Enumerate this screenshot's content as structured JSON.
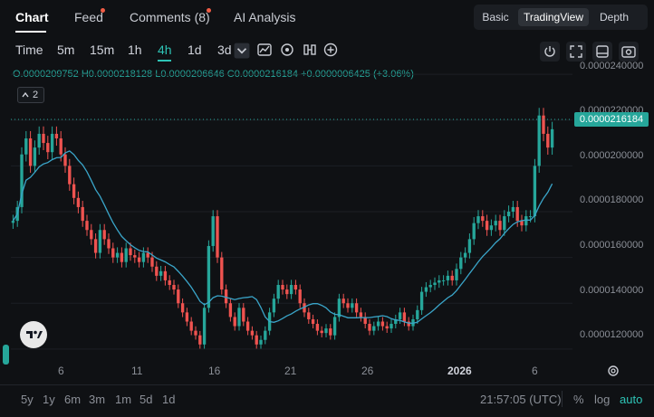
{
  "top_tabs": [
    {
      "label": "Chart",
      "active": true,
      "dot": false
    },
    {
      "label": "Feed",
      "active": false,
      "dot": true
    },
    {
      "label": "Comments (8)",
      "active": false,
      "dot": true
    },
    {
      "label": "AI Analysis",
      "active": false,
      "dot": false
    }
  ],
  "view_modes": [
    {
      "label": "Basic",
      "active": false
    },
    {
      "label": "TradingView",
      "active": true
    },
    {
      "label": "Depth",
      "active": false
    }
  ],
  "toolbar": {
    "time_label": "Time",
    "intervals": [
      {
        "label": "5m",
        "active": false
      },
      {
        "label": "15m",
        "active": false
      },
      {
        "label": "1h",
        "active": false
      },
      {
        "label": "4h",
        "active": true
      },
      {
        "label": "1d",
        "active": false
      },
      {
        "label": "3d",
        "active": false
      }
    ],
    "icons": [
      "chevron-down-icon",
      "chart-style-icon",
      "indicator-icon",
      "compare-icon",
      "add-icon"
    ],
    "right_icons": [
      "power-icon",
      "fullscreen-icon",
      "window-icon",
      "camera-icon"
    ]
  },
  "ohlc": {
    "open": "O.0000209752",
    "high": "H0.0000218128",
    "low": "L0.0000206646",
    "close": "C0.0000216184",
    "change": "+0.0000006425 (+3.06%)"
  },
  "indicator_badge": "2",
  "price_axis": [
    "0.0000240000",
    "0.0000220000",
    "0.0000200000",
    "0.0000180000",
    "0.0000160000",
    "0.0000140000",
    "0.0000120000"
  ],
  "current_price": "0.0000216184",
  "time_axis": [
    {
      "label": "6",
      "bold": false
    },
    {
      "label": "11",
      "bold": false
    },
    {
      "label": "16",
      "bold": false
    },
    {
      "label": "21",
      "bold": false
    },
    {
      "label": "26",
      "bold": false
    },
    {
      "label": "2026",
      "bold": true
    },
    {
      "label": "6",
      "bold": false
    }
  ],
  "ranges": [
    "5y",
    "1y",
    "6m",
    "3m",
    "1m",
    "5d",
    "1d"
  ],
  "clock": "21:57:05 (UTC)",
  "scale_options": [
    {
      "label": "%",
      "active": false
    },
    {
      "label": "log",
      "active": false
    },
    {
      "label": "auto",
      "active": true
    }
  ],
  "colors": {
    "up": "#26a69a",
    "down": "#ef5350",
    "ma": "#3aa5c9",
    "accent": "#2ec4b6"
  },
  "chart_data": {
    "type": "candlestick",
    "ma_color": "#3aa5c9",
    "ylim": [
      1.16e-05,
      2.44e-05
    ],
    "closes": [
      1.76e-05,
      1.82e-05,
      2.05e-05,
      2.12e-05,
      2e-05,
      2.08e-05,
      2.14e-05,
      2.1e-05,
      2.06e-05,
      2.14e-05,
      2.12e-05,
      2.05e-05,
      2e-05,
      1.92e-05,
      1.86e-05,
      1.82e-05,
      1.76e-05,
      1.72e-05,
      1.68e-05,
      1.62e-05,
      1.72e-05,
      1.68e-05,
      1.64e-05,
      1.6e-05,
      1.62e-05,
      1.58e-05,
      1.64e-05,
      1.61e-05,
      1.6e-05,
      1.58e-05,
      1.62e-05,
      1.6e-05,
      1.56e-05,
      1.52e-05,
      1.54e-05,
      1.5e-05,
      1.48e-05,
      1.46e-05,
      1.4e-05,
      1.36e-05,
      1.32e-05,
      1.28e-05,
      1.26e-05,
      1.22e-05,
      1.38e-05,
      1.65e-05,
      1.78e-05,
      1.6e-05,
      1.46e-05,
      1.4e-05,
      1.34e-05,
      1.3e-05,
      1.38e-05,
      1.32e-05,
      1.28e-05,
      1.26e-05,
      1.22e-05,
      1.24e-05,
      1.28e-05,
      1.36e-05,
      1.42e-05,
      1.48e-05,
      1.46e-05,
      1.44e-05,
      1.48e-05,
      1.46e-05,
      1.4e-05,
      1.36e-05,
      1.33e-05,
      1.31e-05,
      1.28e-05,
      1.27e-05,
      1.29e-05,
      1.26e-05,
      1.34e-05,
      1.42e-05,
      1.4e-05,
      1.38e-05,
      1.4e-05,
      1.36e-05,
      1.34e-05,
      1.31e-05,
      1.28e-05,
      1.3e-05,
      1.32e-05,
      1.3e-05,
      1.29e-05,
      1.31e-05,
      1.33e-05,
      1.36e-05,
      1.32e-05,
      1.3e-05,
      1.33e-05,
      1.37e-05,
      1.45e-05,
      1.47e-05,
      1.48e-05,
      1.49e-05,
      1.5e-05,
      1.5e-05,
      1.52e-05,
      1.5e-05,
      1.55e-05,
      1.6e-05,
      1.62e-05,
      1.68e-05,
      1.75e-05,
      1.78e-05,
      1.76e-05,
      1.72e-05,
      1.74e-05,
      1.76e-05,
      1.72e-05,
      1.78e-05,
      1.8e-05,
      1.82e-05,
      1.76e-05,
      1.74e-05,
      1.78e-05,
      1.78e-05,
      2e-05,
      2.22e-05,
      2.14e-05,
      2.08e-05,
      2.16e-05
    ]
  }
}
